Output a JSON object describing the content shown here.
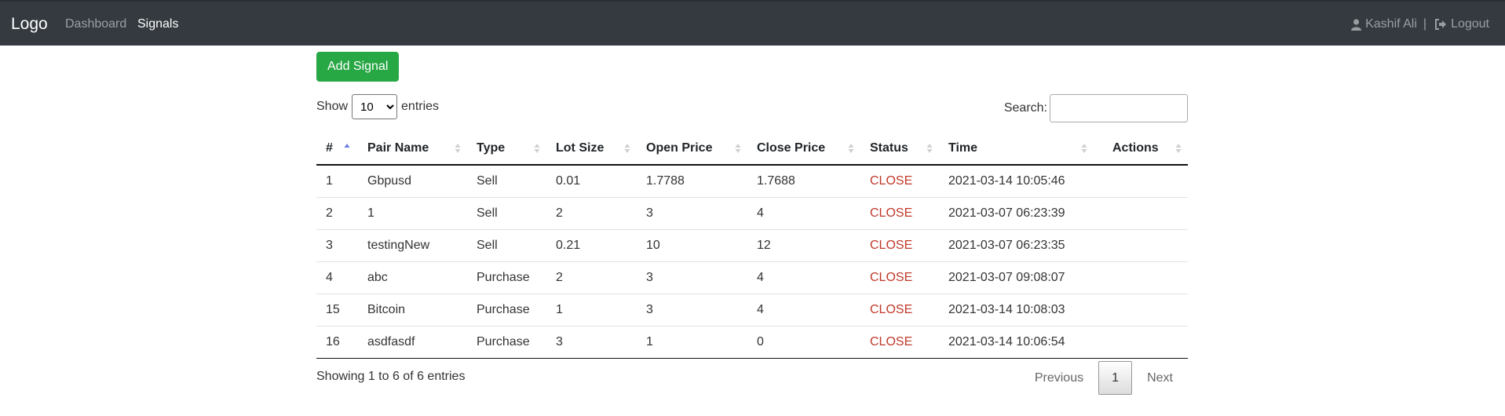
{
  "navbar": {
    "brand": "Logo",
    "links": [
      "Dashboard",
      "Signals"
    ],
    "user": "Kashif Ali",
    "separator": "|",
    "logout": "Logout"
  },
  "actions": {
    "add_signal": "Add Signal"
  },
  "length": {
    "show": "Show",
    "value": "10",
    "entries": "entries"
  },
  "search": {
    "label": "Search:",
    "value": ""
  },
  "table": {
    "columns": [
      "#",
      "Pair Name",
      "Type",
      "Lot Size",
      "Open Price",
      "Close Price",
      "Status",
      "Time",
      "Actions"
    ],
    "rows": [
      {
        "id": "1",
        "pair": "Gbpusd",
        "type": "Sell",
        "lot": "0.01",
        "open": "1.7788",
        "close": "1.7688",
        "status": "CLOSE",
        "time": "2021-03-14 10:05:46",
        "actions": ""
      },
      {
        "id": "2",
        "pair": "1",
        "type": "Sell",
        "lot": "2",
        "open": "3",
        "close": "4",
        "status": "CLOSE",
        "time": "2021-03-07 06:23:39",
        "actions": ""
      },
      {
        "id": "3",
        "pair": "testingNew",
        "type": "Sell",
        "lot": "0.21",
        "open": "10",
        "close": "12",
        "status": "CLOSE",
        "time": "2021-03-07 06:23:35",
        "actions": ""
      },
      {
        "id": "4",
        "pair": "abc",
        "type": "Purchase",
        "lot": "2",
        "open": "3",
        "close": "4",
        "status": "CLOSE",
        "time": "2021-03-07 09:08:07",
        "actions": ""
      },
      {
        "id": "15",
        "pair": "Bitcoin",
        "type": "Purchase",
        "lot": "1",
        "open": "3",
        "close": "4",
        "status": "CLOSE",
        "time": "2021-03-14 10:08:03",
        "actions": ""
      },
      {
        "id": "16",
        "pair": "asdfasdf",
        "type": "Purchase",
        "lot": "3",
        "open": "1",
        "close": "0",
        "status": "CLOSE",
        "time": "2021-03-14 10:06:54",
        "actions": ""
      }
    ]
  },
  "footer": {
    "info": "Showing 1 to 6 of 6 entries",
    "previous": "Previous",
    "page": "1",
    "next": "Next"
  },
  "colors": {
    "navbar": "#343a40",
    "add_button": "#28a745",
    "status_close": "#c0392b"
  },
  "icons": {
    "user": "user-icon",
    "logout": "sign-out-icon"
  }
}
